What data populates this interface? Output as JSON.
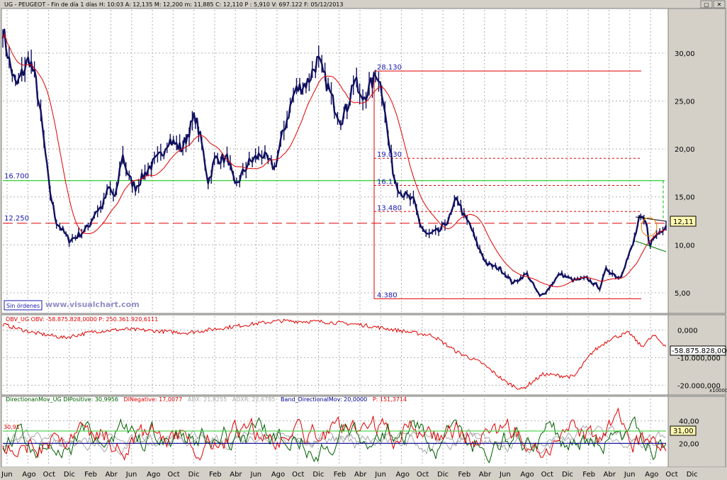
{
  "window": {
    "title": "UG - PEUGEOT - Fin de día 1 días  H: 10:03  A: 12,135  M: 12,200  m: 11,885  C: 12,110  P : 5,910  V: 697.122  F: 05/12/2013",
    "button_labels": [
      "▢",
      "✕"
    ],
    "status_badge": "Sin órdenes",
    "watermark": "www.visualchart.com"
  },
  "price_panel": {
    "y_ticks": [
      "30,00",
      "25,00",
      "20,00",
      "15,00",
      "10,00",
      "5,00"
    ],
    "current_value_label": "12,11",
    "levels": [
      {
        "text": "28.130",
        "value": 28.13
      },
      {
        "text": "19.030",
        "value": 19.03
      },
      {
        "text": "16.1",
        "value": 16.2
      },
      {
        "text": "13.480",
        "value": 13.48
      },
      {
        "text": "4.380",
        "value": 4.38
      },
      {
        "text": "16.700",
        "value": 16.7
      },
      {
        "text": "12.250",
        "value": 12.25
      }
    ]
  },
  "obv_panel": {
    "legend": "OBV_UG  OBV: -58.875.828,0000   P: 250.361.920,6111",
    "y_ticks": [
      "0,000",
      "-10.000,000",
      "-20.000,000"
    ],
    "current_value_label": "-58.875.828,000",
    "scale_note": "x10000"
  },
  "dmi_panel": {
    "legend_parts": [
      {
        "text": "DirectionanMov_UG  DIPositive: 30,9956",
        "color": "#006000"
      },
      {
        "text": "DINegative: 17,0077",
        "color": "#e00000"
      },
      {
        "text": "ADX: 21,8255",
        "color": "#a8a8a8"
      },
      {
        "text": "ADXR: 22,6785",
        "color": "#a8a8a8"
      },
      {
        "text": "Band_DirectionalMov: 20,0000",
        "color": "#000090"
      },
      {
        "text": "P: 151,3714",
        "color": "#e00000"
      }
    ],
    "y_ticks": [
      "40,00",
      "20,00"
    ],
    "current_value_label": "31,00",
    "left_value_label": "30,91"
  },
  "x_axis": {
    "labels": [
      "Jun",
      "Ago",
      "Oct",
      "Dic",
      "Feb",
      "Abr",
      "Jun",
      "Ago",
      "Oct",
      "Dic",
      "Feb",
      "Abr",
      "Jun",
      "Ago",
      "Oct",
      "Dic",
      "Feb",
      "Abr",
      "Jun",
      "Ago",
      "Oct",
      "Dic",
      "Feb",
      "Abr",
      "Jun",
      "Ago",
      "Oct",
      "Dic",
      "Feb",
      "Abr",
      "Jun",
      "Ago",
      "Oct",
      "Dic"
    ]
  },
  "colors": {
    "panel_bg": "#ffffff",
    "frame_bg": "#d4d0c8",
    "price_bars": "#101060",
    "moving_average": "#e00000",
    "fib_lines": "#e00000",
    "support_green": "#00c000",
    "grid": "#b0b0b0",
    "label_blue": "#1818b0"
  },
  "chart_data": [
    {
      "type": "line",
      "title": "UG - PEUGEOT",
      "y_range": [
        3.0,
        34.5
      ],
      "x_range": [
        0,
        1
      ],
      "price_anchors": [
        [
          0.0,
          32.5
        ],
        [
          0.01,
          29.0
        ],
        [
          0.02,
          26.5
        ],
        [
          0.03,
          28.0
        ],
        [
          0.04,
          29.5
        ],
        [
          0.05,
          27.0
        ],
        [
          0.06,
          22.0
        ],
        [
          0.07,
          16.0
        ],
        [
          0.08,
          12.5
        ],
        [
          0.09,
          11.5
        ],
        [
          0.1,
          10.5
        ],
        [
          0.11,
          10.8
        ],
        [
          0.12,
          11.3
        ],
        [
          0.13,
          12.0
        ],
        [
          0.14,
          13.5
        ],
        [
          0.15,
          14.0
        ],
        [
          0.16,
          16.0
        ],
        [
          0.17,
          14.8
        ],
        [
          0.18,
          19.5
        ],
        [
          0.19,
          17.0
        ],
        [
          0.2,
          16.0
        ],
        [
          0.22,
          18.0
        ],
        [
          0.24,
          19.5
        ],
        [
          0.25,
          21.0
        ],
        [
          0.27,
          20.0
        ],
        [
          0.29,
          23.5
        ],
        [
          0.3,
          20.5
        ],
        [
          0.31,
          16.5
        ],
        [
          0.32,
          19.0
        ],
        [
          0.34,
          19.0
        ],
        [
          0.35,
          16.0
        ],
        [
          0.37,
          18.5
        ],
        [
          0.39,
          19.5
        ],
        [
          0.41,
          18.0
        ],
        [
          0.42,
          21.0
        ],
        [
          0.43,
          23.5
        ],
        [
          0.44,
          26.0
        ],
        [
          0.46,
          27.0
        ],
        [
          0.475,
          29.3
        ],
        [
          0.49,
          26.5
        ],
        [
          0.5,
          24.5
        ],
        [
          0.51,
          23.0
        ],
        [
          0.52,
          24.5
        ],
        [
          0.53,
          27.5
        ],
        [
          0.54,
          25.0
        ],
        [
          0.55,
          26.0
        ],
        [
          0.565,
          28.0
        ],
        [
          0.575,
          25.0
        ],
        [
          0.58,
          21.5
        ],
        [
          0.59,
          17.0
        ],
        [
          0.6,
          15.5
        ],
        [
          0.61,
          15.0
        ],
        [
          0.62,
          14.5
        ],
        [
          0.63,
          12.0
        ],
        [
          0.64,
          11.0
        ],
        [
          0.66,
          11.5
        ],
        [
          0.675,
          13.0
        ],
        [
          0.685,
          15.0
        ],
        [
          0.695,
          13.0
        ],
        [
          0.705,
          12.0
        ],
        [
          0.715,
          10.0
        ],
        [
          0.73,
          8.0
        ],
        [
          0.75,
          7.5
        ],
        [
          0.77,
          6.0
        ],
        [
          0.79,
          7.0
        ],
        [
          0.81,
          4.6
        ],
        [
          0.82,
          5.2
        ],
        [
          0.84,
          7.0
        ],
        [
          0.86,
          6.3
        ],
        [
          0.88,
          6.5
        ],
        [
          0.9,
          5.5
        ],
        [
          0.91,
          7.5
        ],
        [
          0.93,
          6.5
        ],
        [
          0.95,
          10.0
        ],
        [
          0.96,
          12.8
        ],
        [
          0.97,
          12.3
        ],
        [
          0.975,
          10.0
        ],
        [
          0.985,
          11.0
        ],
        [
          1.0,
          12.1
        ]
      ],
      "series": [
        {
          "name": "Precio",
          "color": "#101060"
        },
        {
          "name": "Media móvil",
          "color": "#e00000"
        }
      ]
    },
    {
      "type": "line",
      "title": "OBV_UG",
      "y_range": [
        -23000000,
        5000000
      ],
      "unit_note": "x10000",
      "anchors": [
        [
          0.0,
          2000000
        ],
        [
          0.05,
          -1000000
        ],
        [
          0.1,
          -2800000
        ],
        [
          0.15,
          -500000
        ],
        [
          0.2,
          300000
        ],
        [
          0.3,
          -1000000
        ],
        [
          0.4,
          2000000
        ],
        [
          0.45,
          3300000
        ],
        [
          0.52,
          3000000
        ],
        [
          0.58,
          2000000
        ],
        [
          0.64,
          0
        ],
        [
          0.7,
          -2000000
        ],
        [
          0.74,
          -8000000
        ],
        [
          0.78,
          -12000000
        ],
        [
          0.82,
          -19000000
        ],
        [
          0.845,
          -21500000
        ],
        [
          0.88,
          -16000000
        ],
        [
          0.93,
          -17000000
        ],
        [
          0.96,
          -8000000
        ],
        [
          0.99,
          -3000000
        ],
        [
          1.02,
          -1000000
        ],
        [
          1.04,
          -6000000
        ],
        [
          1.06,
          -2000000
        ],
        [
          1.08,
          -5800000
        ]
      ]
    },
    {
      "type": "line",
      "title": "DirectionanMov_UG",
      "y_range": [
        0,
        60
      ],
      "band": 20,
      "upper_line": 31,
      "series": [
        {
          "name": "DIPositive",
          "last": 30.9956,
          "color": "#006000"
        },
        {
          "name": "DINegative",
          "last": 17.0077,
          "color": "#e00000"
        },
        {
          "name": "ADX",
          "last": 21.8255,
          "color": "#a8a8a8"
        },
        {
          "name": "ADXR",
          "last": 22.6785,
          "color": "#a8a8a8"
        }
      ]
    }
  ]
}
